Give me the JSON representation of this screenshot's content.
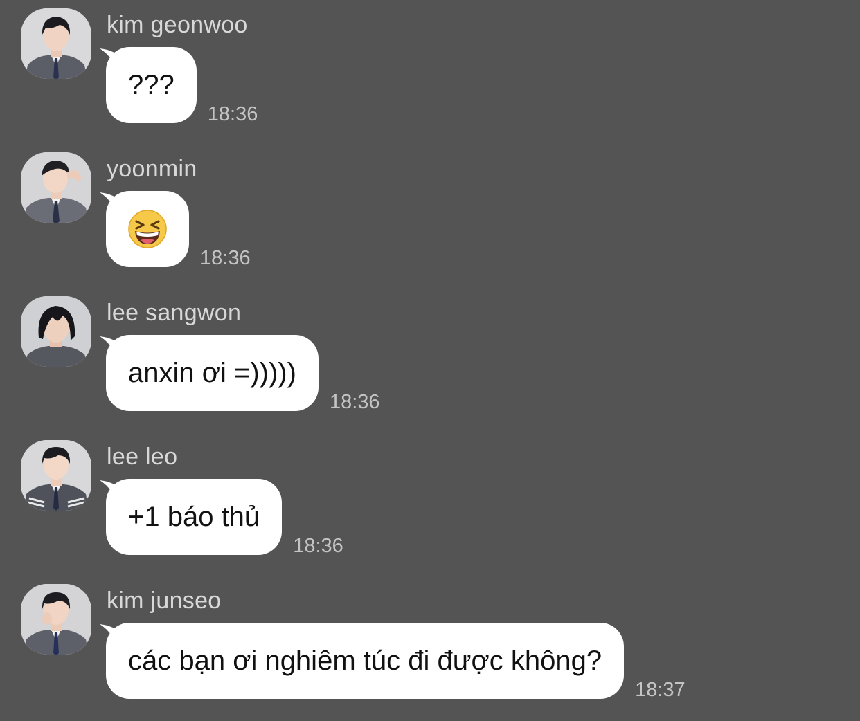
{
  "messages": [
    {
      "sender": "kim geonwoo",
      "text": "???",
      "time": "18:36"
    },
    {
      "sender": "yoonmin",
      "text": "",
      "emoji": "grinning-squinting-face",
      "time": "18:36"
    },
    {
      "sender": "lee sangwon",
      "text": "anxin ơi =)))))",
      "time": "18:36"
    },
    {
      "sender": "lee leo",
      "text": "+1 báo thủ",
      "time": "18:36"
    },
    {
      "sender": "kim junseo",
      "text": "các bạn ơi nghiêm túc đi được không?",
      "time": "18:37"
    }
  ],
  "colors": {
    "background": "#545454",
    "bubble": "#ffffff",
    "sender_text": "#d8d8d8",
    "time_text": "#c4c4c4",
    "message_text": "#111111"
  }
}
